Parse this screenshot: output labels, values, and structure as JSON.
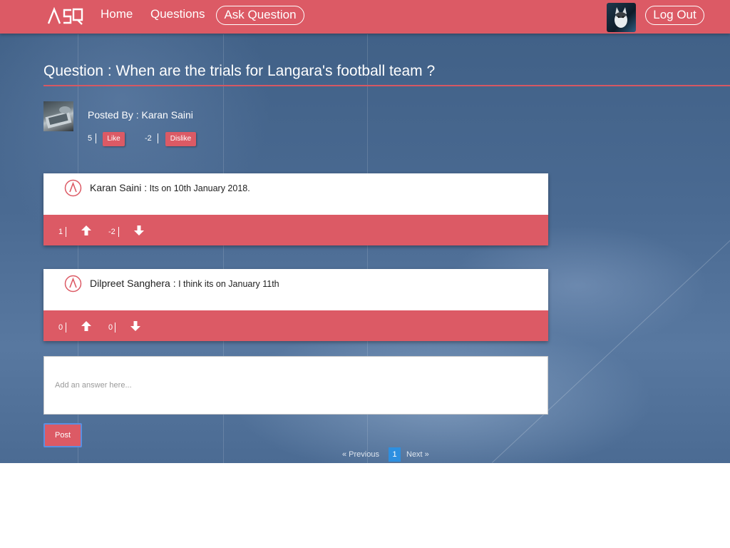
{
  "nav": {
    "brand": "ASQ",
    "home": "Home",
    "questions": "Questions",
    "ask": "Ask Question",
    "logout": "Log Out"
  },
  "question": {
    "title": "Question : When are the trials for Langara's football team ?",
    "posted_by": "Posted By : Karan Saini",
    "likes": "5",
    "like_label": "Like",
    "dislikes": "-2",
    "dislike_label": "Dislike"
  },
  "answers": [
    {
      "author": "Karan Saini :",
      "text": " Its on 10th January 2018.",
      "upvotes": "1",
      "downvotes": "-2"
    },
    {
      "author": "Dilpreet Sanghera :",
      "text": " I think its on January 11th",
      "upvotes": "0",
      "downvotes": "0"
    }
  ],
  "answer_form": {
    "placeholder": "Add an answer here...",
    "post_label": "Post"
  },
  "pagination": {
    "previous": "« Previous",
    "current": "1",
    "next": "Next »"
  },
  "colors": {
    "accent": "#dc5a65",
    "page_current": "#2d8fe0"
  },
  "icons": {
    "logo": "asq-logo",
    "answer_logo": "caret-circle-icon",
    "upvote": "arrow-up-icon",
    "downvote": "arrow-down-icon"
  }
}
